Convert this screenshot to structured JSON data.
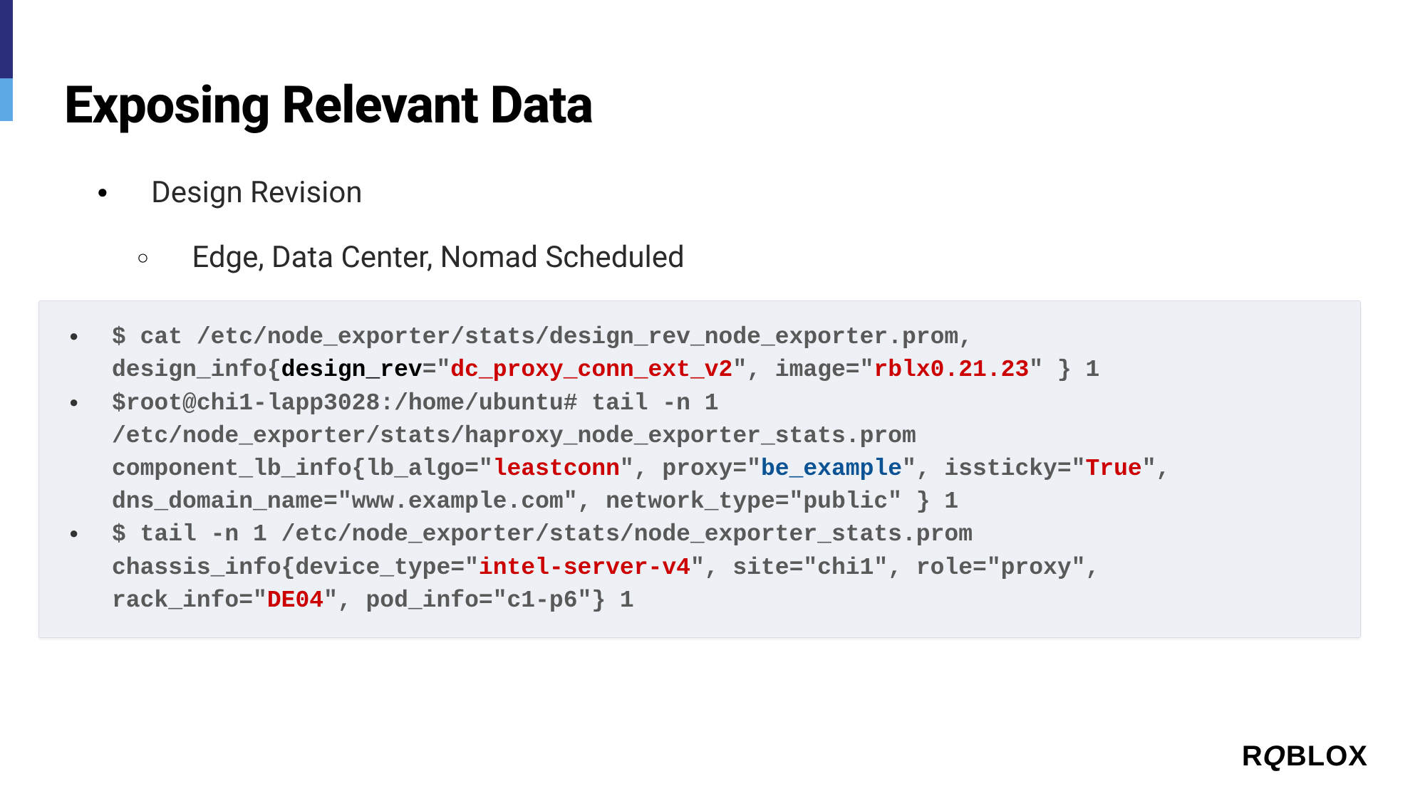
{
  "title": "Exposing Relevant Data",
  "bullets": {
    "main": "Design Revision",
    "sub": "Edge, Data Center, Nomad Scheduled"
  },
  "code": {
    "line1_cmd": "$ cat /etc/node_exporter/stats/design_rev_node_exporter.prom,",
    "line1_metric_a": "design_info{",
    "line1_metric_b": "design_rev",
    "line1_metric_c": "=\"",
    "line1_val1": "dc_proxy_conn_ext_v2",
    "line1_metric_d": "\", image=\"",
    "line1_val2": "rblx0.21.23",
    "line1_metric_e": "\" } 1",
    "line2_cmd": "$root@chi1-lapp3028:/home/ubuntu# tail -n 1 /etc/node_exporter/stats/haproxy_node_exporter_stats.prom",
    "line2_metric_a": "component_lb_info{lb_algo=\"",
    "line2_val1": "leastconn",
    "line2_metric_b": "\", proxy=\"",
    "line2_val2": "be_example",
    "line2_metric_c": "\", issticky=\"",
    "line2_val3": "True",
    "line2_metric_d": "\", dns_domain_name=\"www.example.com\", network_type=\"public\" } 1",
    "line3_cmd": "$ tail -n 1 /etc/node_exporter/stats/node_exporter_stats.prom",
    "line3_metric_a": "chassis_info{device_type=\"",
    "line3_val1": "intel-server-v4",
    "line3_metric_b": "\", site=\"chi1\", role=\"proxy\", rack_info=\"",
    "line3_val2": "DE04",
    "line3_metric_c": "\", pod_info=\"c1-p6\"} 1"
  },
  "logo": "ROBLOX"
}
